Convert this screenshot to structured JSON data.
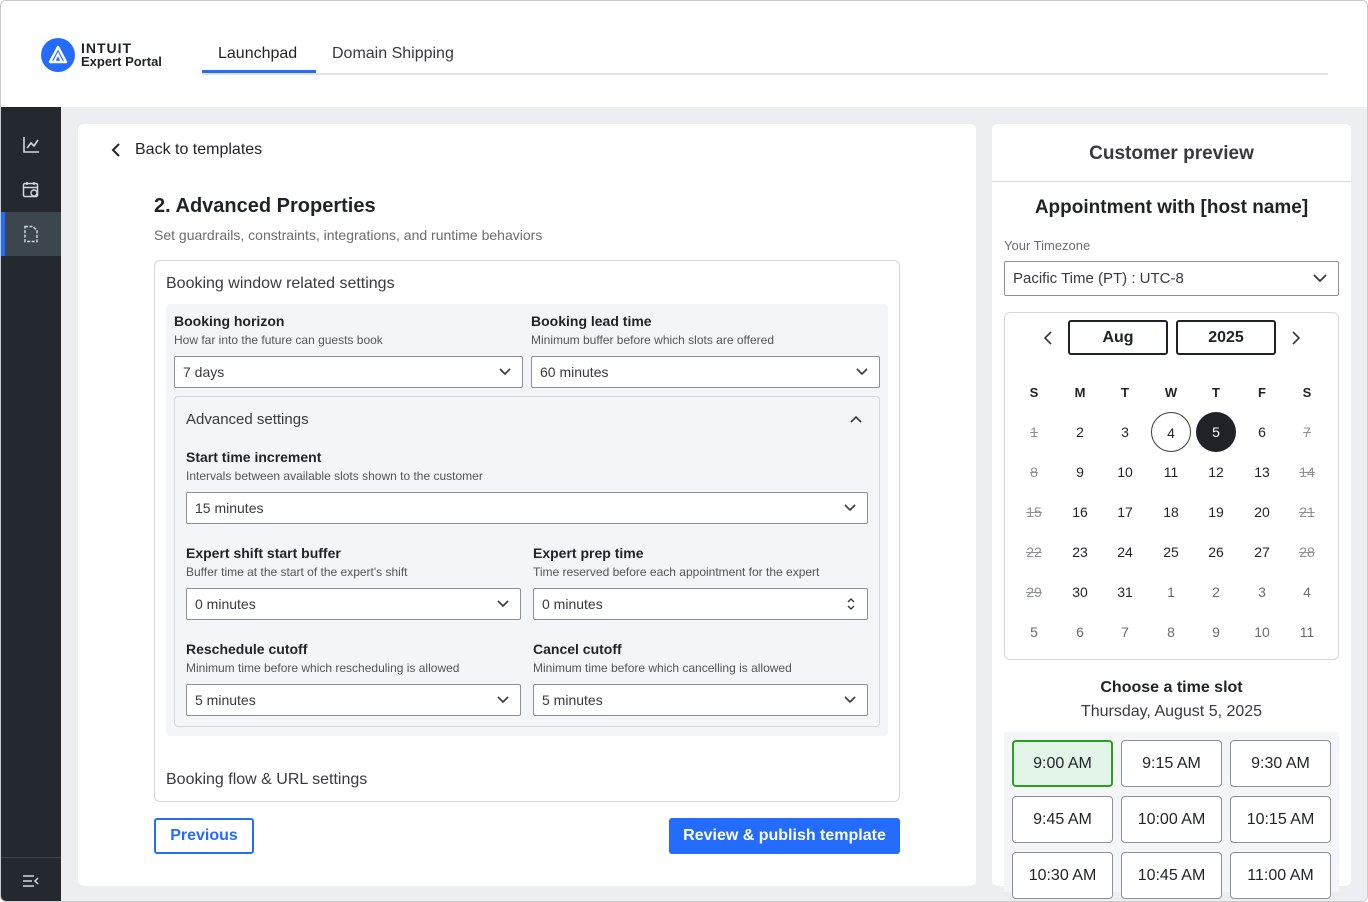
{
  "brand": {
    "line1": "INTUIT",
    "line2": "Expert Portal",
    "accent": "#236cff"
  },
  "nav_tabs": [
    {
      "label": "Launchpad"
    },
    {
      "label": "Domain Shipping"
    }
  ],
  "rail": {
    "items": [
      "chart-icon",
      "calendar-settings-icon",
      "document-icon"
    ],
    "bottom": "collapse-menu-icon"
  },
  "main": {
    "back_label": "Back to templates",
    "title": "2. Advanced Properties",
    "subtitle": "Set guardrails, constraints, integrations, and runtime behaviors",
    "section1": "Booking window related settings",
    "section2": "Booking flow & URL settings",
    "booking_horizon": {
      "label": "Booking horizon",
      "help": "How far into the future can guests book",
      "value": "7 days"
    },
    "booking_lead": {
      "label": "Booking lead time",
      "help": "Minimum buffer before which slots are offered",
      "value": "60 minutes"
    },
    "advanced": {
      "title": "Advanced settings",
      "start_increment": {
        "label": "Start time increment",
        "help": "Intervals between available slots shown to the customer",
        "value": "15 minutes"
      },
      "shift_buffer": {
        "label": "Expert shift start buffer",
        "help": "Buffer time at the start of the expert's shift",
        "value": "0 minutes"
      },
      "prep_time": {
        "label": "Expert prep time",
        "help": "Time reserved before each appointment for the expert",
        "value": "0 minutes"
      },
      "reschedule": {
        "label": "Reschedule cutoff",
        "help": "Minimum time before which rescheduling is allowed",
        "value": "5 minutes"
      },
      "cancel": {
        "label": "Cancel cutoff",
        "help": "Minimum time before which cancelling is allowed",
        "value": "5 minutes"
      }
    },
    "prev_button": "Previous",
    "publish_button": "Review & publish template"
  },
  "preview": {
    "title": "Customer preview",
    "appointment": "Appointment with [host name]",
    "tz_label": "Your Timezone",
    "tz_value": "Pacific Time (PT) : UTC-8",
    "month": "Aug",
    "year": "2025",
    "dow": [
      "S",
      "M",
      "T",
      "W",
      "T",
      "F",
      "S"
    ],
    "weeks": [
      [
        "1",
        "2",
        "3",
        "4",
        "5",
        "6",
        "7"
      ],
      [
        "8",
        "9",
        "10",
        "11",
        "12",
        "13",
        "14"
      ],
      [
        "15",
        "16",
        "17",
        "18",
        "19",
        "20",
        "21"
      ],
      [
        "22",
        "23",
        "24",
        "25",
        "26",
        "27",
        "28"
      ],
      [
        "29",
        "30",
        "31",
        "1",
        "2",
        "3",
        "4"
      ],
      [
        "5",
        "6",
        "7",
        "8",
        "9",
        "10",
        "11"
      ]
    ],
    "slot_title": "Choose a time slot",
    "slot_date": "Thursday, August 5, 2025",
    "slots": [
      "9:00 AM",
      "9:15 AM",
      "9:30 AM",
      "9:45 AM",
      "10:00 AM",
      "10:15 AM",
      "10:30 AM",
      "10:45 AM",
      "11:00 AM"
    ],
    "colors": {
      "selected_slot_bg": "#e3f5e9",
      "selected_slot_border": "#2ca01c",
      "selected_day": "#1f2328"
    }
  }
}
